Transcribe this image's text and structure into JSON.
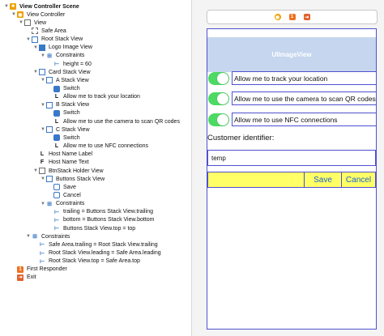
{
  "outline": {
    "items": [
      {
        "label": "View Controller Scene",
        "depth": 0,
        "tri": "▼",
        "icon": "scene-icon",
        "bold": true
      },
      {
        "label": "View Controller",
        "depth": 1,
        "tri": "▼",
        "icon": "view-controller-icon"
      },
      {
        "label": "View",
        "depth": 2,
        "tri": "▼",
        "icon": "view-icon"
      },
      {
        "label": "Safe Area",
        "depth": 3,
        "tri": "",
        "icon": "safe-area-icon"
      },
      {
        "label": "Root Stack View",
        "depth": 3,
        "tri": "▼",
        "icon": "stack-view-icon"
      },
      {
        "label": "Logo Image View",
        "depth": 4,
        "tri": "▼",
        "icon": "image-view-icon"
      },
      {
        "label": "Constraints",
        "depth": 5,
        "tri": "▼",
        "icon": "constraints-icon"
      },
      {
        "label": "height = 60",
        "depth": 6,
        "tri": "",
        "icon": "constraint-icon"
      },
      {
        "label": "Card Stack View",
        "depth": 4,
        "tri": "▼",
        "icon": "stack-view-icon"
      },
      {
        "label": "A Stack View",
        "depth": 5,
        "tri": "▼",
        "icon": "stack-view-icon"
      },
      {
        "label": "Switch",
        "depth": 6,
        "tri": "",
        "icon": "switch-icon"
      },
      {
        "label": "Allow me to track your location",
        "depth": 6,
        "tri": "",
        "icon": "label-icon"
      },
      {
        "label": "B Stack View",
        "depth": 5,
        "tri": "▼",
        "icon": "stack-view-icon"
      },
      {
        "label": "Switch",
        "depth": 6,
        "tri": "",
        "icon": "switch-icon"
      },
      {
        "label": "Allow me to use the camera to scan QR codes",
        "depth": 6,
        "tri": "",
        "icon": "label-icon"
      },
      {
        "label": "C Stack View",
        "depth": 5,
        "tri": "▼",
        "icon": "stack-view-icon"
      },
      {
        "label": "Switch",
        "depth": 6,
        "tri": "",
        "icon": "switch-icon"
      },
      {
        "label": "Allow me to use NFC connections",
        "depth": 6,
        "tri": "",
        "icon": "label-icon"
      },
      {
        "label": "Host Name Label",
        "depth": 4,
        "tri": "",
        "icon": "label-icon"
      },
      {
        "label": "Host Name Text",
        "depth": 4,
        "tri": "",
        "icon": "text-field-icon"
      },
      {
        "label": "BtnStack Holder View",
        "depth": 4,
        "tri": "▼",
        "icon": "view-icon"
      },
      {
        "label": "Buttons Stack View",
        "depth": 5,
        "tri": "▼",
        "icon": "stack-view-icon"
      },
      {
        "label": "Save",
        "depth": 6,
        "tri": "",
        "icon": "button-icon"
      },
      {
        "label": "Cancel",
        "depth": 6,
        "tri": "",
        "icon": "button-icon"
      },
      {
        "label": "Constraints",
        "depth": 5,
        "tri": "▼",
        "icon": "constraints-icon"
      },
      {
        "label": "trailing = Buttons Stack View.trailing",
        "depth": 6,
        "tri": "",
        "icon": "constraint-icon"
      },
      {
        "label": "bottom = Buttons Stack View.bottom",
        "depth": 6,
        "tri": "",
        "icon": "constraint-icon"
      },
      {
        "label": "Buttons Stack View.top = top",
        "depth": 6,
        "tri": "",
        "icon": "constraint-icon"
      },
      {
        "label": "Constraints",
        "depth": 3,
        "tri": "▼",
        "icon": "constraints-icon"
      },
      {
        "label": "Safe Area.trailing = Root Stack View.trailing",
        "depth": 4,
        "tri": "",
        "icon": "constraint-icon"
      },
      {
        "label": "Root Stack View.leading = Safe Area.leading",
        "depth": 4,
        "tri": "",
        "icon": "constraint-icon"
      },
      {
        "label": "Root Stack View.top = Safe Area.top",
        "depth": 4,
        "tri": "",
        "icon": "constraint-icon"
      },
      {
        "label": "First Responder",
        "depth": 1,
        "tri": "",
        "icon": "first-responder-icon"
      },
      {
        "label": "Exit",
        "depth": 1,
        "tri": "",
        "icon": "exit-icon"
      }
    ]
  },
  "canvas": {
    "scene_bar_icons": [
      "view-controller-icon",
      "first-responder-icon",
      "exit-icon"
    ],
    "logo_label": "UIImageView",
    "cards": [
      {
        "label": "Allow me to track your location",
        "on": true
      },
      {
        "label": "Allow me to use the camera to scan QR codes",
        "on": true
      },
      {
        "label": "Allow me to use NFC connections",
        "on": true
      }
    ],
    "host_label": "Customer identifier:",
    "host_text_value": "temp",
    "save_label": "Save",
    "cancel_label": "Cancel"
  }
}
